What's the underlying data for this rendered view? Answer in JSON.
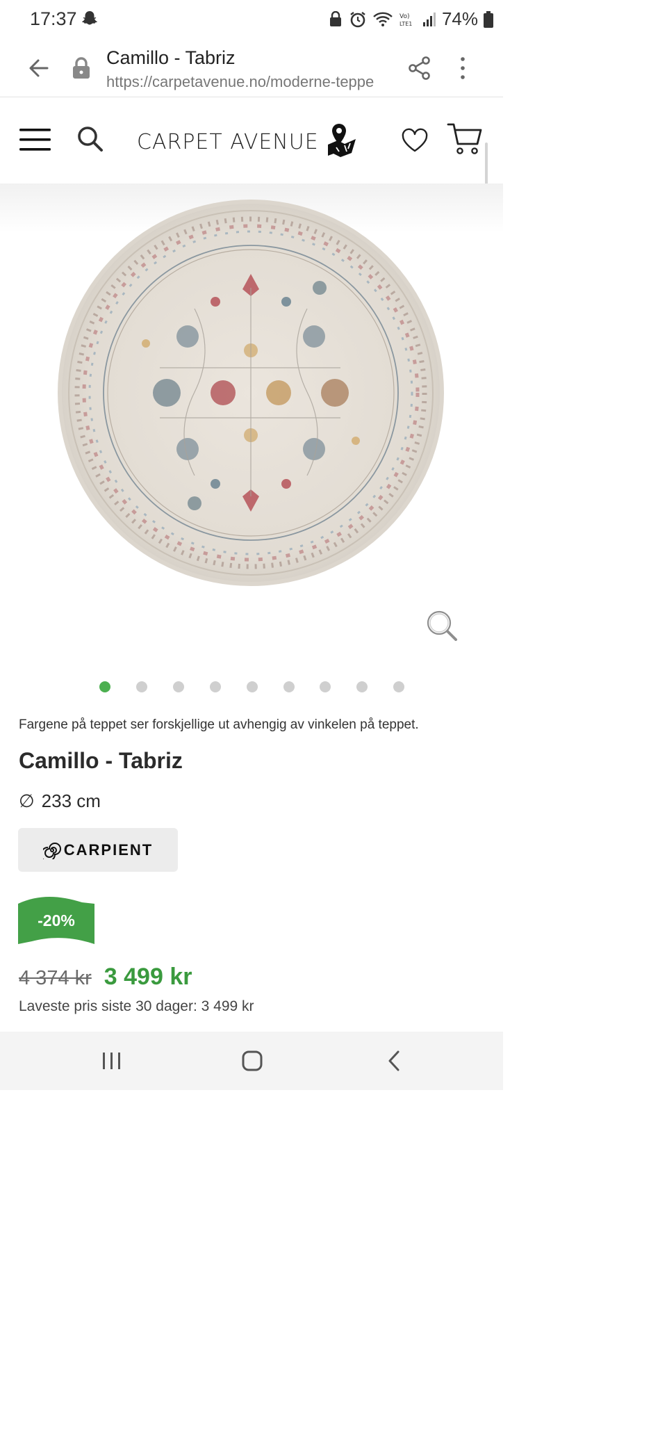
{
  "status_bar": {
    "time": "17:37",
    "battery": "74%"
  },
  "browser": {
    "page_title": "Camillo - Tabriz",
    "url": "https://carpetavenue.no/moderne-teppe"
  },
  "site_header": {
    "brand": "CARPET AVENUE"
  },
  "gallery": {
    "dot_count": 9,
    "active_dot": 0
  },
  "product": {
    "disclaimer": "Fargene på teppet ser forskjellige ut avhengig av vinkelen på teppet.",
    "name": "Camillo - Tabriz",
    "size_symbol": "∅",
    "size": "233 cm",
    "brand_badge": "CARPIENT",
    "discount": "-20%",
    "old_price": "4 374 kr",
    "new_price": "3 499 kr",
    "lowest_price": "Laveste pris siste 30 dager: 3 499 kr"
  },
  "colors": {
    "accent_green": "#3a9a3e",
    "discount_flag": "#43a047",
    "active_dot": "#4caf50"
  },
  "icons": [
    "back-arrow-icon",
    "lock-icon",
    "share-icon",
    "more-icon",
    "menu-icon",
    "search-icon",
    "map-pin-icon",
    "heart-icon",
    "cart-icon",
    "zoom-icon",
    "carpient-swirl-icon"
  ]
}
